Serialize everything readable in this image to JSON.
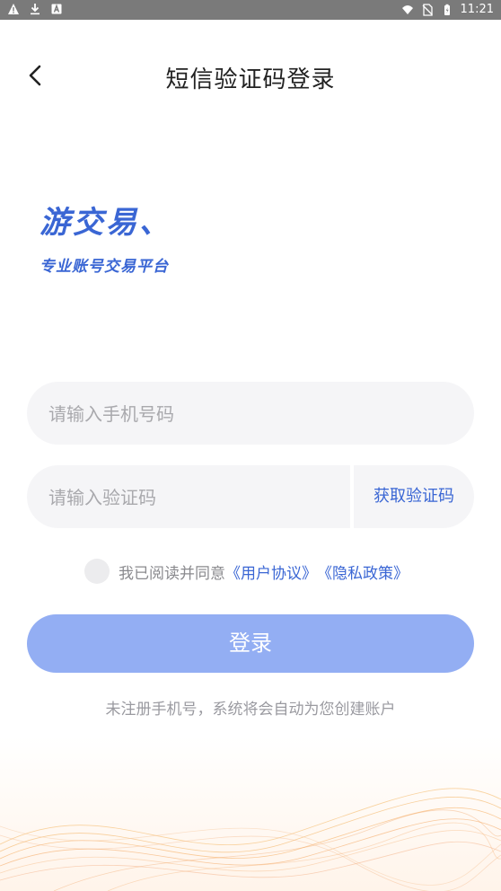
{
  "status_bar": {
    "time": "11:21",
    "left_icons": [
      "warning-icon",
      "download-icon",
      "accessibility-icon"
    ],
    "right_icons": [
      "wifi-icon",
      "no-sim-icon",
      "battery-icon"
    ]
  },
  "header": {
    "back_icon": "chevron-left-icon",
    "title": "短信验证码登录"
  },
  "logo": {
    "main": "游交易、",
    "sub": "专业账号交易平台"
  },
  "form": {
    "phone_placeholder": "请输入手机号码",
    "code_placeholder": "请输入验证码",
    "get_code_label": "获取验证码",
    "agree_prefix": "我已阅读并同意",
    "user_agreement": "《用户协议》",
    "privacy_policy": "《隐私政策》",
    "login_label": "登录",
    "note": "未注册手机号，系统将会自动为您创建账户"
  },
  "colors": {
    "accent": "#3a66d4",
    "button": "#93aef3",
    "field_bg": "#f5f5f7",
    "status_bar": "#7a7a7a"
  }
}
